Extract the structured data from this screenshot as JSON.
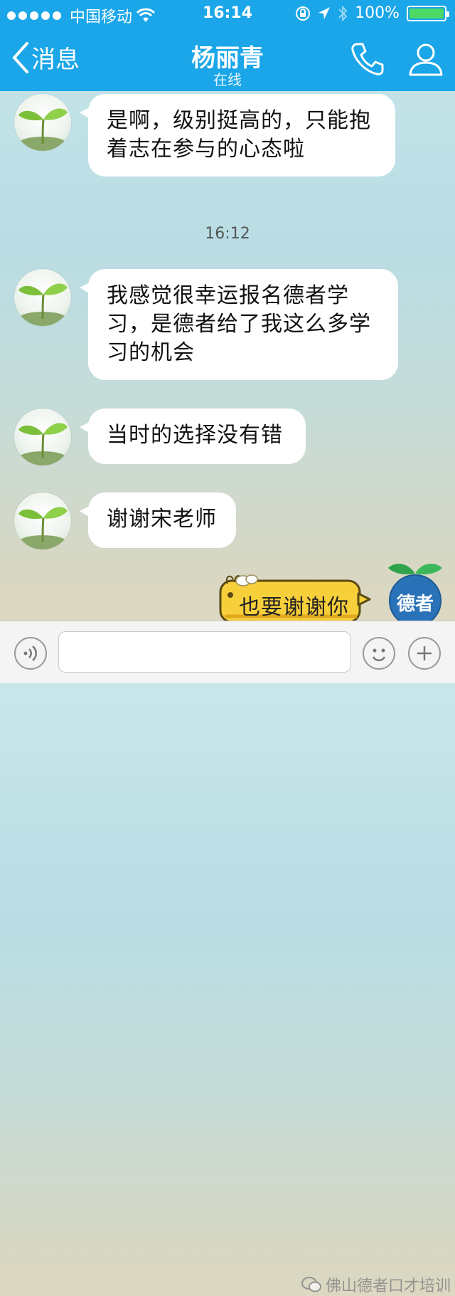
{
  "status_bar": {
    "carrier": "中国移动",
    "time": "16:14",
    "battery": "100%",
    "battery_level": 1.0
  },
  "nav": {
    "back_label": "消息",
    "contact_name": "杨丽青",
    "contact_status": "在线"
  },
  "messages": [
    {
      "text_line1": "是啊，级别挺高的，只能抱",
      "text_line2": "着志在参与的心态啦"
    },
    {
      "text_line1": "我感觉很幸运报名德者学",
      "text_line2": "习，是德者给了我这么多学",
      "text_line3": "习的机会"
    },
    {
      "text": "当时的选择没有错"
    },
    {
      "text": "谢谢宋老师"
    }
  ],
  "timestamp": "16:12",
  "my_message": "也要谢谢你",
  "my_avatar_text": "德者",
  "watermark": "佛山德者口才培训",
  "colors": {
    "nav_blue": "#1aa6e8",
    "bubble_white": "#ffffff",
    "my_bubble_yellow": "#f7cf3a",
    "battery_green": "#4cd964"
  },
  "icons": [
    "wifi-icon",
    "lock-rotation-icon",
    "location-arrow-icon",
    "bluetooth-icon",
    "back-chevron-icon",
    "phone-icon",
    "profile-icon",
    "voice-icon",
    "emoji-icon",
    "plus-icon",
    "wechat-icon"
  ]
}
